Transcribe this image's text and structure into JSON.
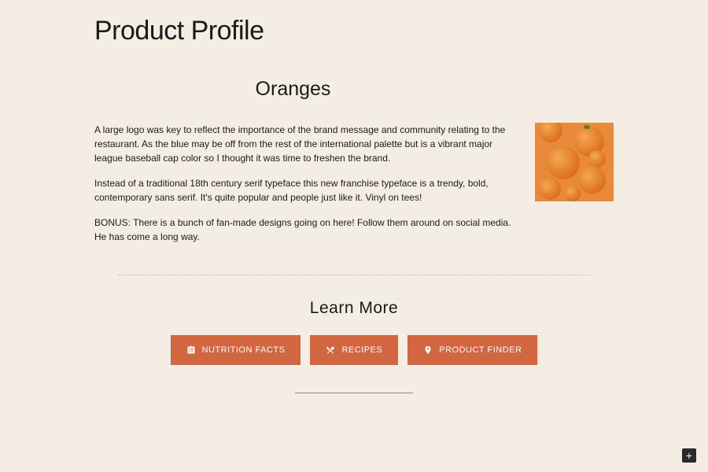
{
  "page": {
    "title": "Product Profile"
  },
  "product": {
    "name": "Oranges",
    "paragraphs": [
      "A large logo was key to reflect the importance of the brand message and community relating to the restaurant. As the blue may be off from the rest of the international palette but is a vibrant major league baseball cap color so I thought it was time to freshen the brand.",
      "Instead of a traditional 18th century serif typeface this new franchise typeface is a trendy, bold, contemporary sans serif. It's quite popular and people just like it. Vinyl on tees!",
      "BONUS: There is a bunch of fan-made designs going on here! Follow them around on social media. He has come a long way."
    ],
    "image_alt": "oranges"
  },
  "learn_more": {
    "title": "Learn More",
    "buttons": {
      "nutrition": "NUTRITION FACTS",
      "recipes": "RECIPES",
      "finder": "PRODUCT FINDER"
    }
  },
  "colors": {
    "accent": "#d16640",
    "background": "#f3ede4"
  }
}
